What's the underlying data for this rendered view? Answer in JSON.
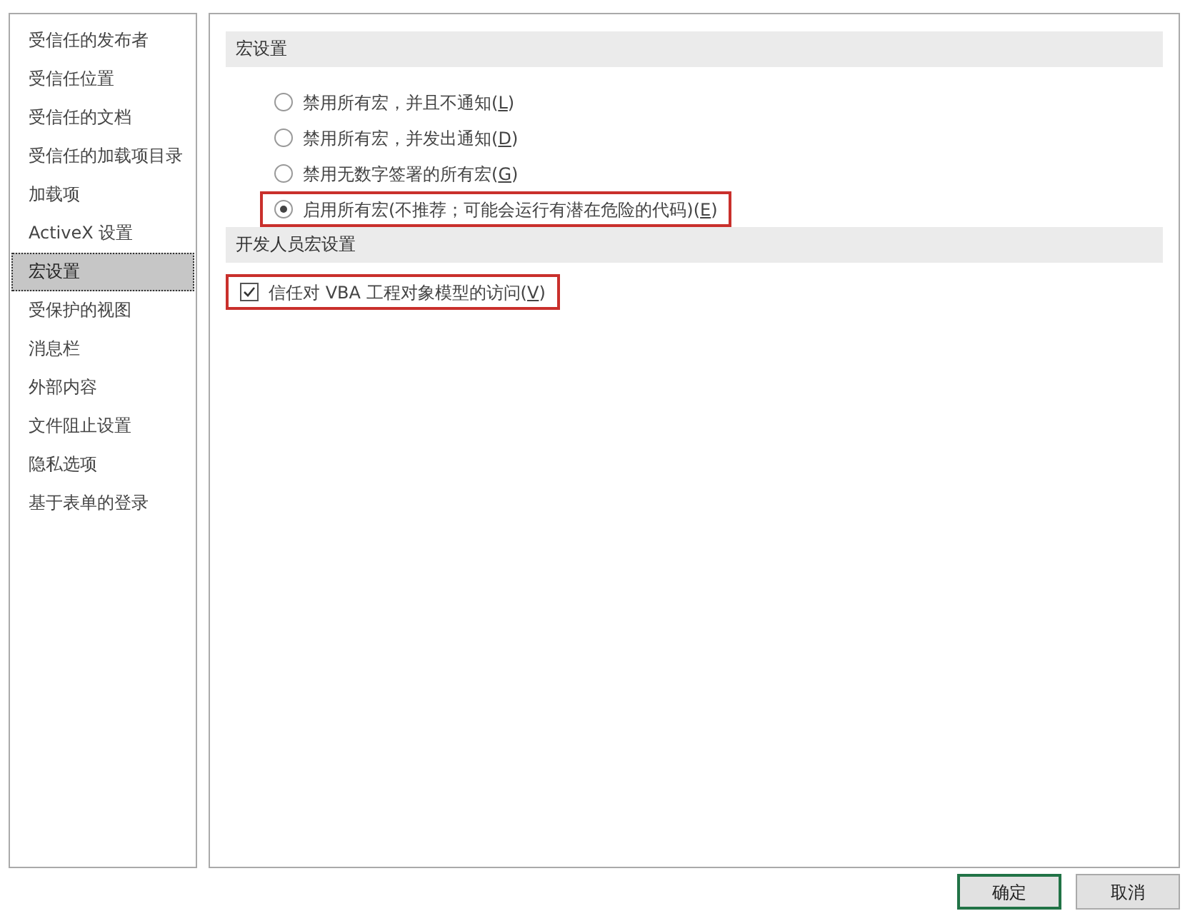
{
  "sidebar": {
    "items": [
      {
        "label": "受信任的发布者",
        "selected": false
      },
      {
        "label": "受信任位置",
        "selected": false
      },
      {
        "label": "受信任的文档",
        "selected": false
      },
      {
        "label": "受信任的加载项目录",
        "selected": false
      },
      {
        "label": "加载项",
        "selected": false
      },
      {
        "label": "ActiveX 设置",
        "selected": false
      },
      {
        "label": "宏设置",
        "selected": true
      },
      {
        "label": "受保护的视图",
        "selected": false
      },
      {
        "label": "消息栏",
        "selected": false
      },
      {
        "label": "外部内容",
        "selected": false
      },
      {
        "label": "文件阻止设置",
        "selected": false
      },
      {
        "label": "隐私选项",
        "selected": false
      },
      {
        "label": "基于表单的登录",
        "selected": false
      }
    ]
  },
  "sections": [
    {
      "title": "宏设置",
      "options": [
        {
          "kind": "radio",
          "text": "禁用所有宏，并且不通知(",
          "access_key": "L",
          "text_end": ")",
          "selected": false,
          "highlighted": false
        },
        {
          "kind": "radio",
          "text": "禁用所有宏，并发出通知(",
          "access_key": "D",
          "text_end": ")",
          "selected": false,
          "highlighted": false
        },
        {
          "kind": "radio",
          "text": "禁用无数字签署的所有宏(",
          "access_key": "G",
          "text_end": ")",
          "selected": false,
          "highlighted": false
        },
        {
          "kind": "radio",
          "text": "启用所有宏(不推荐；可能会运行有潜在危险的代码)(",
          "access_key": "E",
          "text_end": ")",
          "selected": true,
          "highlighted": true
        }
      ]
    },
    {
      "title": "开发人员宏设置",
      "options": [
        {
          "kind": "checkbox",
          "text": "信任对 VBA 工程对象模型的访问(",
          "access_key": "V",
          "text_end": ")",
          "checked": true,
          "highlighted": true
        }
      ]
    }
  ],
  "buttons": [
    {
      "label": "确定",
      "default": true
    },
    {
      "label": "取消",
      "default": false
    }
  ]
}
